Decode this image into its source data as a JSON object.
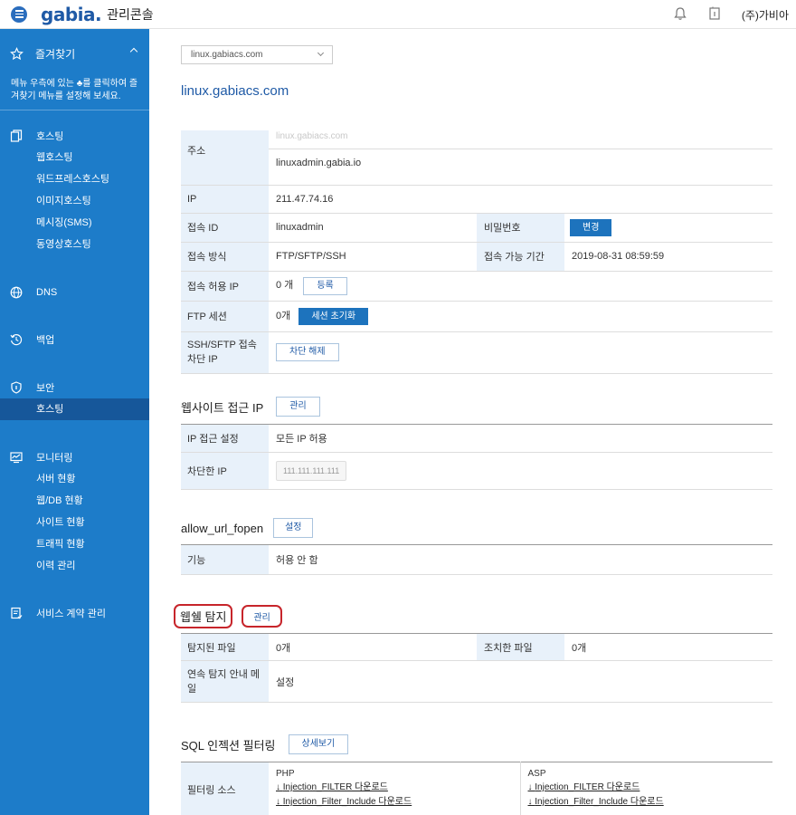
{
  "header": {
    "logo": "gabia.",
    "console_title": "관리콘솔",
    "company": "(주)가비아"
  },
  "sidebar": {
    "favorites_label": "즐겨찾기",
    "favorites_note": "메뉴 우측에 있는 ♣를 클릭하여 즐겨찾기 메뉴를 설정해 보세요.",
    "hosting_label": "호스팅",
    "hosting_items": [
      "웹호스팅",
      "워드프레스호스팅",
      "이미지호스팅",
      "메시징(SMS)",
      "동영상호스팅"
    ],
    "dns_label": "DNS",
    "backup_label": "백업",
    "security_label": "보안",
    "security_items": [
      "호스팅"
    ],
    "monitoring_label": "모니터링",
    "monitoring_items": [
      "서버 현황",
      "웹/DB 현황",
      "사이트 현황",
      "트래픽 현황",
      "이력 관리"
    ],
    "contract_label": "서비스 계약 관리"
  },
  "main": {
    "domain_select": "linux.gabiacs.com",
    "domain_title": "linux.gabiacs.com",
    "info": {
      "address_label": "주소",
      "address_faded": "linux.gabiacs.com",
      "address_value": "linuxadmin.gabia.io",
      "ip_label": "IP",
      "ip_value": "211.47.74.16",
      "id_label": "접속 ID",
      "id_value": "linuxadmin",
      "pw_label": "비밀번호",
      "pw_button": "변경",
      "method_label": "접속 방식",
      "method_value": "FTP/SFTP/SSH",
      "period_label": "접속 가능 기간",
      "period_value": "2019-08-31 08:59:59",
      "allow_ip_label": "접속 허용 IP",
      "allow_ip_value": "0 개",
      "allow_ip_button": "등록",
      "ftp_label": "FTP 세션",
      "ftp_value": "0개",
      "ftp_button": "세션 초기화",
      "ssh_label": "SSH/SFTP 접속 차단 IP",
      "ssh_button": "차단 해제"
    },
    "website_ip": {
      "title": "웹사이트 접근 IP",
      "button": "관리",
      "setting_label": "IP 접근 설정",
      "setting_value": "모든 IP 허용",
      "blocked_label": "차단한 IP",
      "blocked_placeholder": "111.111.111.111"
    },
    "url_fopen": {
      "title": "allow_url_fopen",
      "button": "설정",
      "feature_label": "기능",
      "feature_value": "허용 안 함"
    },
    "webshell": {
      "title": "웹쉘 탐지",
      "button": "관리",
      "detected_label": "탐지된 파일",
      "detected_value": "0개",
      "handled_label": "조치한 파일",
      "handled_value": "0개",
      "notice_label": "연속 탐지 안내 메일",
      "notice_value": "설정"
    },
    "sql": {
      "title": "SQL 인젝션 필터링",
      "button": "상세보기",
      "source_label": "필터링 소스",
      "php_label": "PHP",
      "php_links": [
        "Injection_FILTER 다운로드",
        "Injection_Filter_Include 다운로드"
      ],
      "asp_label": "ASP",
      "asp_links": [
        "Injection_FILTER 다운로드",
        "Injection_Filter_Include 다운로드"
      ]
    }
  },
  "colors": {
    "sidebar": "#1d7cc9",
    "active": "#16579a",
    "accent": "#1d73bd",
    "highlight": "#c7252b"
  }
}
